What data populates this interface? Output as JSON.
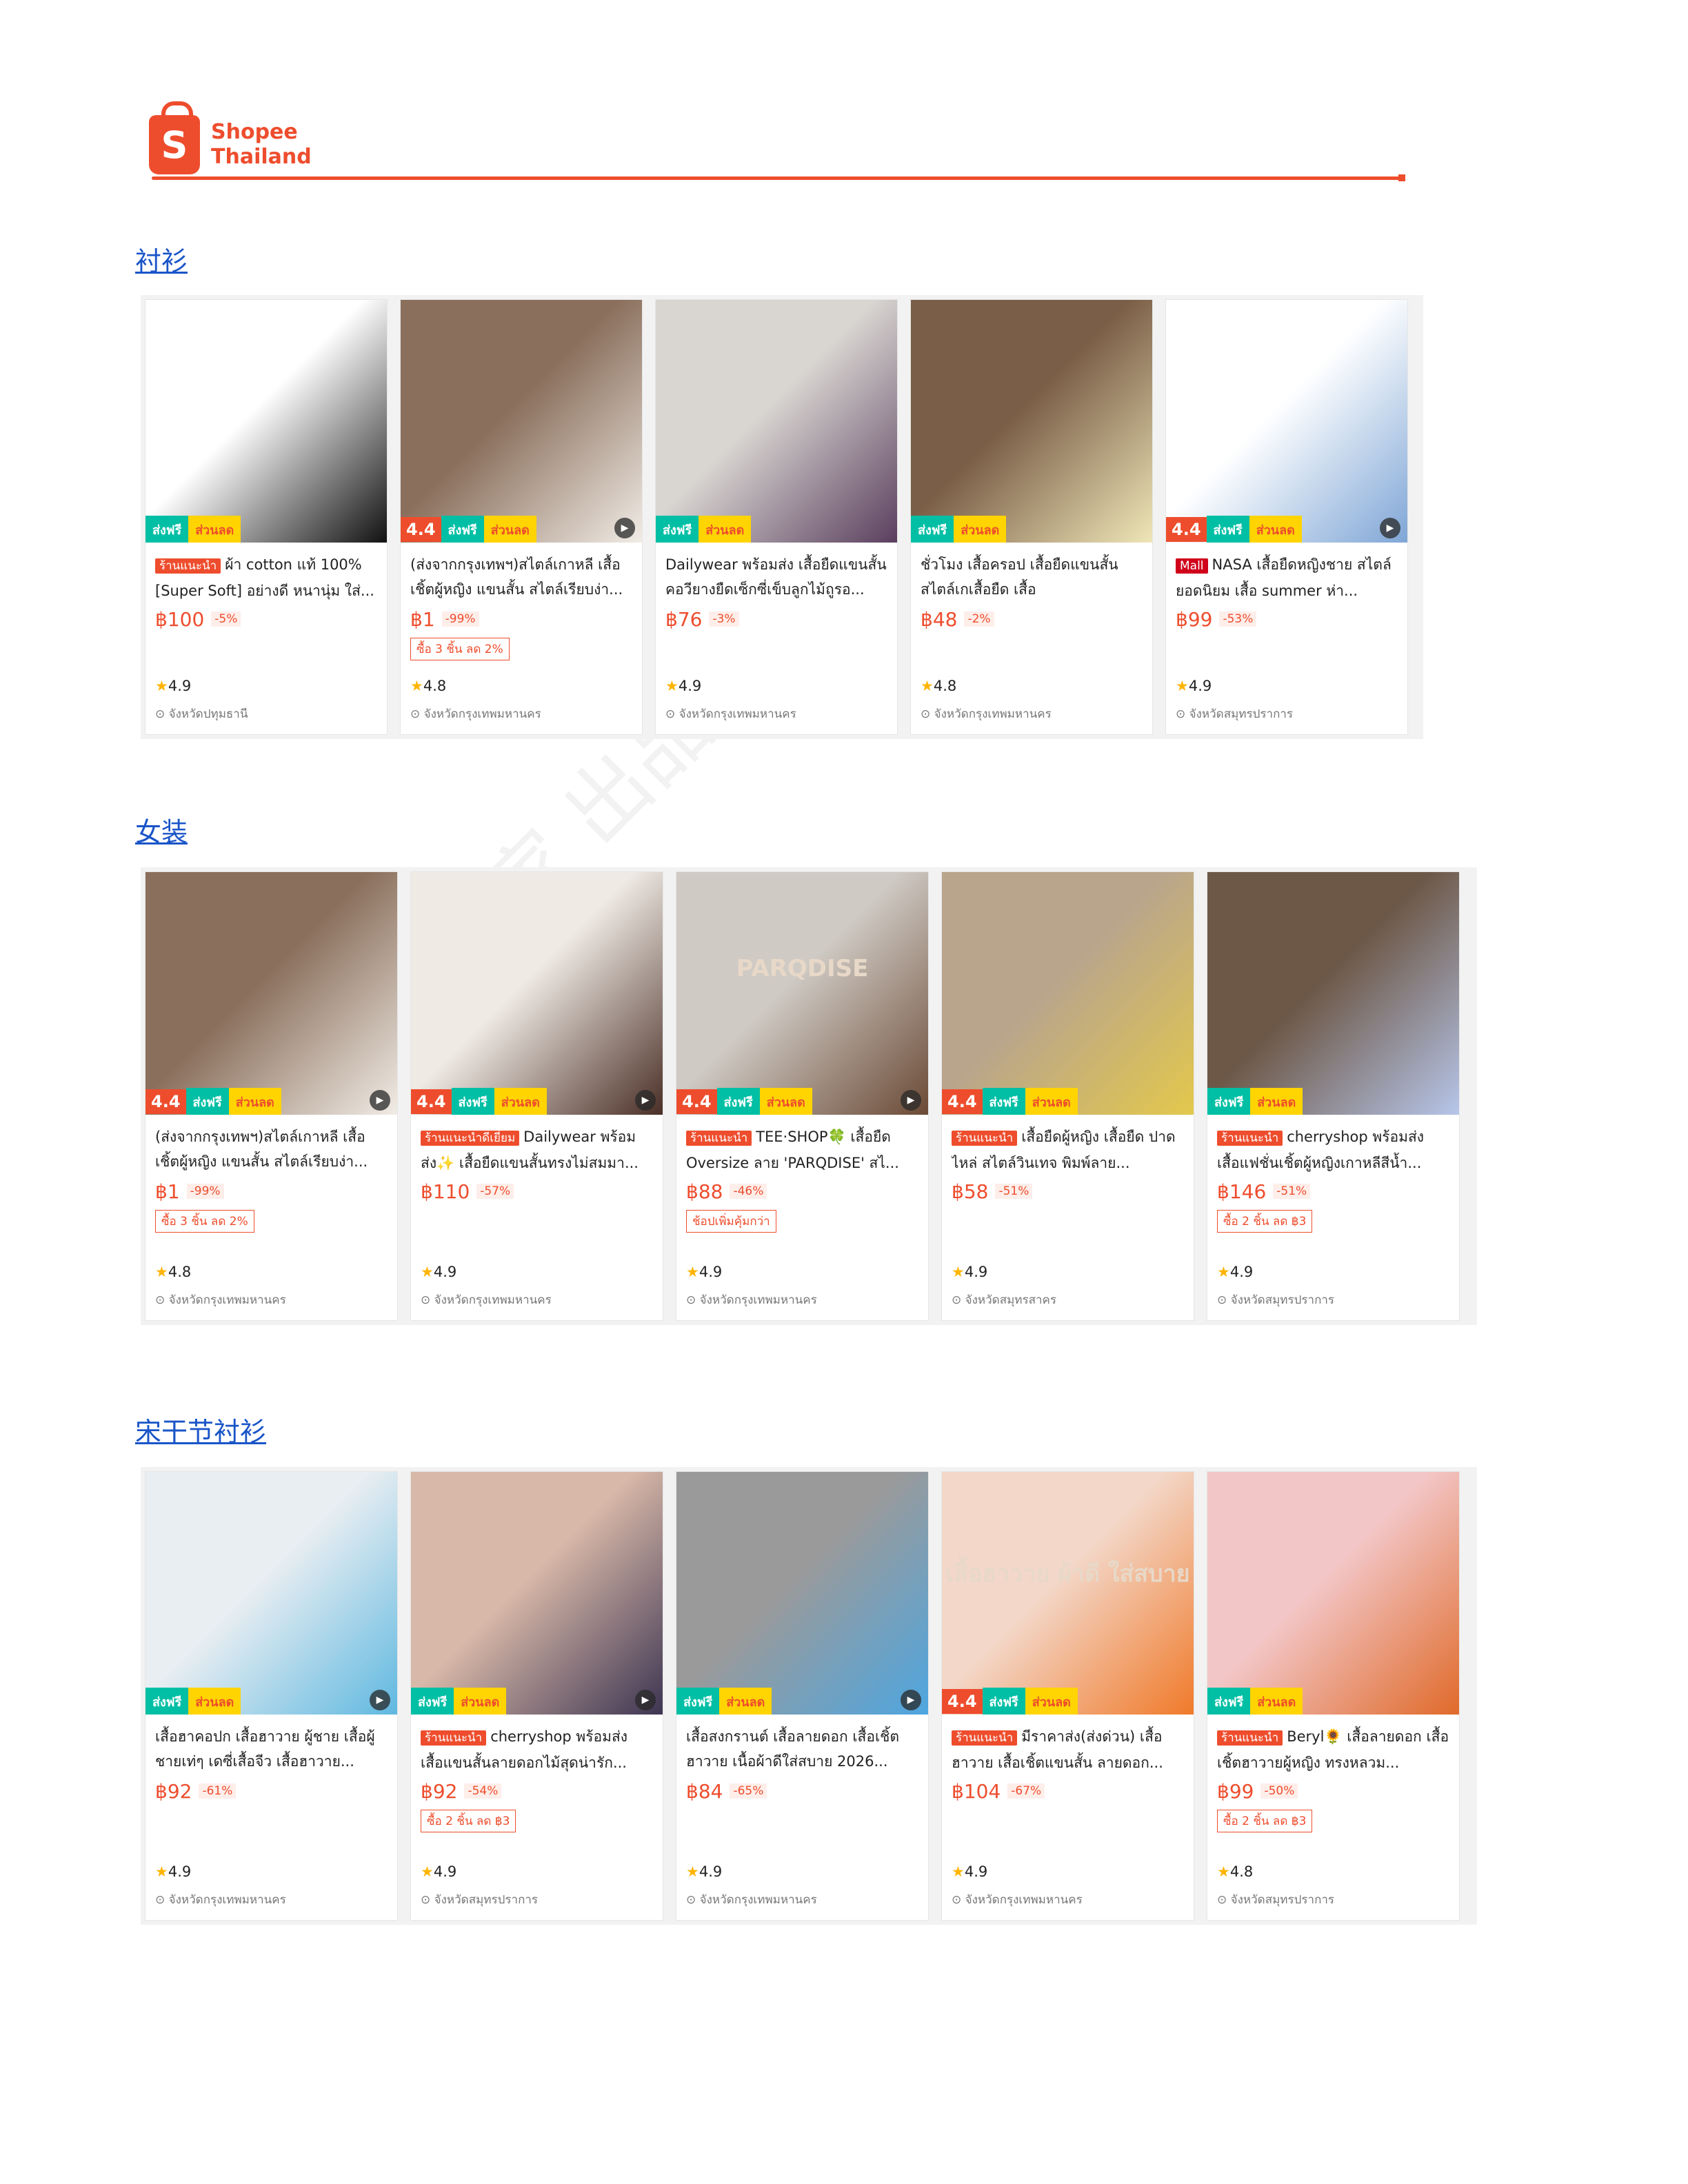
{
  "logo": {
    "line1": "Shopee",
    "line2": "Thailand",
    "icon": "shopee-bag-icon",
    "icon_letter": "S"
  },
  "sections": [
    {
      "title": "衬衫",
      "products": [
        {
          "tag": "ร้านแนะนำ",
          "title": "ผ้า cotton แท้ 100% [Super Soft] อย่างดี หนานุ่ม ใส่...",
          "price": "฿100",
          "pct": "-5%",
          "promo": "",
          "rating": "4.9",
          "location": "จังหวัดปทุมธานี",
          "rating_badge": "",
          "video": false,
          "colors": [
            "#ffffff",
            "#111111"
          ]
        },
        {
          "tag": "",
          "title": "(ส่งจากกรุงเทพฯ)สไตล์เกาหลี เสื้อเชิ้ตผู้หญิง แขนสั้น สไตล์เรียบง่า...",
          "price": "฿1",
          "pct": "-99%",
          "promo": "ซื้อ 3 ชิ้น ลด 2%",
          "rating": "4.8",
          "location": "จังหวัดกรุงเทพมหานคร",
          "rating_badge": "4.4",
          "video": true,
          "colors": [
            "#8a6f5c",
            "#f1ece6"
          ]
        },
        {
          "tag": "",
          "title": "Dailywear พร้อมส่ง เสื้อยืดแขนสั้น คอวียางยืดเซ็กซี่เข็บลูกไม้ถูรอ...",
          "price": "฿76",
          "pct": "-3%",
          "promo": "",
          "rating": "4.9",
          "location": "จังหวัดกรุงเทพมหานคร",
          "rating_badge": "",
          "video": false,
          "colors": [
            "#d9d6d2",
            "#5a3f5e"
          ]
        },
        {
          "tag": "",
          "title": "ชั่วโมง เสื้อครอป เสื้อยืดแขนสั้น สไตล์เกเสื้อยืด เสื้อ",
          "price": "฿48",
          "pct": "-2%",
          "promo": "",
          "rating": "4.8",
          "location": "จังหวัดกรุงเทพมหานคร",
          "rating_badge": "",
          "video": false,
          "colors": [
            "#7a5e47",
            "#efe6b8"
          ]
        },
        {
          "tag": "Mall",
          "title": "NASA เสื้อยืดหญิงชาย สไตล์ยอดนิยม เสื้อ summer ห่า...",
          "price": "฿99",
          "pct": "-53%",
          "promo": "",
          "rating": "4.9",
          "location": "จังหวัดสมุทรปราการ",
          "rating_badge": "4.4",
          "video": true,
          "colors": [
            "#ffffff",
            "#7fa6d6"
          ]
        }
      ]
    },
    {
      "title": "女装",
      "products": [
        {
          "tag": "",
          "title": "(ส่งจากกรุงเทพฯ)สไตล์เกาหลี เสื้อเชิ้ตผู้หญิง แขนสั้น สไตล์เรียบง่า...",
          "price": "฿1",
          "pct": "-99%",
          "promo": "ซื้อ 3 ชิ้น ลด 2%",
          "rating": "4.8",
          "location": "จังหวัดกรุงเทพมหานคร",
          "rating_badge": "4.4",
          "video": true,
          "colors": [
            "#8a6f5c",
            "#f1ece6"
          ]
        },
        {
          "tag": "ร้านแนะนำดีเยี่ยม",
          "title": "Dailywear พร้อมส่ง✨ เสื้อยืดแขนสั้นทรงไม่สมมา...",
          "price": "฿110",
          "pct": "-57%",
          "promo": "",
          "rating": "4.9",
          "location": "จังหวัดกรุงเทพมหานคร",
          "rating_badge": "4.4",
          "video": true,
          "colors": [
            "#efeae4",
            "#4a2f26"
          ]
        },
        {
          "tag": "ร้านแนะนำ",
          "title": "TEE·SHOP🍀 เสื้อยืด Oversize ลาย 'PARQDISE' สไ...",
          "price": "฿88",
          "pct": "-46%",
          "promo": "ช้อปเพิ่มคุ้มกว่า",
          "rating": "4.9",
          "location": "จังหวัดกรุงเทพมหานคร",
          "rating_badge": "4.4",
          "video": true,
          "colors": [
            "#cfcac4",
            "#6b4a36"
          ],
          "print": "PARQDISE"
        },
        {
          "tag": "ร้านแนะนำ",
          "title": "เสื้อยืดผู้หญิง เสื้อยืด ปาดไหล่ สไตล์วินเทจ พิมพ์ลาย...",
          "price": "฿58",
          "pct": "-51%",
          "promo": "",
          "rating": "4.9",
          "location": "จังหวัดสมุทรสาคร",
          "rating_badge": "4.4",
          "video": false,
          "colors": [
            "#b9a58c",
            "#e3c84c"
          ]
        },
        {
          "tag": "ร้านแนะนำ",
          "title": "cherryshop พร้อมส่ง เสื้อแฟชั่นเชิ้ตผู้หญิงเกาหลีสีน้ำ...",
          "price": "฿146",
          "pct": "-51%",
          "promo": "ซื้อ 2 ชิ้น ลด ฿3",
          "rating": "4.9",
          "location": "จังหวัดสมุทรปราการ",
          "rating_badge": "",
          "video": false,
          "colors": [
            "#6d5847",
            "#b7c6ea"
          ]
        }
      ]
    },
    {
      "title": "宋干节衬衫",
      "products": [
        {
          "tag": "",
          "title": "เสื้อฮาคอปก เสื้อฮาวาย ผู้ชาย เสื้อผู้ชายเท่ๆ เดซี่เสื้อจีว เสื้อฮาวาย...",
          "price": "฿92",
          "pct": "-61%",
          "promo": "",
          "rating": "4.9",
          "location": "จังหวัดกรุงเทพมหานคร",
          "rating_badge": "",
          "video": true,
          "colors": [
            "#e9eef2",
            "#5fb8e0"
          ]
        },
        {
          "tag": "ร้านแนะนำ",
          "title": "cherryshop พร้อมส่ง เสื้อแขนสั้นลายดอกไม้สุดน่ารัก...",
          "price": "฿92",
          "pct": "-54%",
          "promo": "ซื้อ 2 ชิ้น ลด ฿3",
          "rating": "4.9",
          "location": "จังหวัดสมุทรปราการ",
          "rating_badge": "",
          "video": true,
          "colors": [
            "#d8b8a8",
            "#3d3552"
          ]
        },
        {
          "tag": "",
          "title": "เสื้อสงกรานต์ เสื้อลายดอก เสื้อเชิ้ตฮาวาย เนื้อผ้าดีใส่สบาย 2026...",
          "price": "฿84",
          "pct": "-65%",
          "promo": "",
          "rating": "4.9",
          "location": "จังหวัดกรุงเทพมหานคร",
          "rating_badge": "",
          "video": true,
          "colors": [
            "#9a9a9a",
            "#4ea6e0"
          ]
        },
        {
          "tag": "ร้านแนะนำ",
          "title": "มีราคาส่ง(ส่งด่วน) เสื้อฮาวาย เสื้อเชิ้ตแขนสั้น ลายดอก...",
          "price": "฿104",
          "pct": "-67%",
          "promo": "",
          "rating": "4.9",
          "location": "จังหวัดกรุงเทพมหานคร",
          "rating_badge": "4.4",
          "video": false,
          "colors": [
            "#f3d7c8",
            "#f07a2a"
          ],
          "print": "เสื้อฮาวาย ผ้าดี ใส่สบาย"
        },
        {
          "tag": "ร้านแนะนำ",
          "title": "Beryl🌻 เสื้อลายดอก เสื้อเชิ้ตฮาวายผู้หญิง ทรงหลวม...",
          "price": "฿99",
          "pct": "-50%",
          "promo": "ซื้อ 2 ชิ้น ลด ฿3",
          "rating": "4.8",
          "location": "จังหวัดสมุทรปราการ",
          "rating_badge": "",
          "video": false,
          "colors": [
            "#f2c6c6",
            "#e06a2a"
          ]
        }
      ]
    }
  ],
  "badges": {
    "free_shipping": "ส่งฟรี",
    "discount": "ส่วนลด"
  },
  "watermark": "卖家 出品"
}
